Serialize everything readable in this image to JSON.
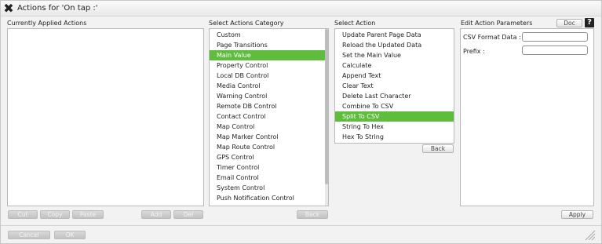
{
  "window": {
    "title": "Actions for 'On tap :'",
    "close_icon": "close-x-icon"
  },
  "applied": {
    "label": "Currently Applied Actions",
    "items": [],
    "buttons": {
      "cut": "Cut",
      "copy": "Copy",
      "paste": "Paste",
      "add": "Add",
      "del": "Del"
    }
  },
  "categories": {
    "label": "Select Actions Category",
    "items": [
      "Custom",
      "Page Transitions",
      "Main Value",
      "Property Control",
      "Local DB Control",
      "Media Control",
      "Warning Control",
      "Remote DB Control",
      "Contact Control",
      "Map Control",
      "Map Marker Control",
      "Map Route Control",
      "GPS Control",
      "Timer Control",
      "Email Control",
      "System Control",
      "Push Notification Control"
    ],
    "selected": "Main Value",
    "back": "Back"
  },
  "actions": {
    "label": "Select Action",
    "items": [
      "Update Parent Page Data",
      "Reload the Updated Data",
      "Set the Main Value",
      "Calculate",
      "Append Text",
      "Clear Text",
      "Delete Last Character",
      "Combine To CSV",
      "Split To CSV",
      "String To Hex",
      "Hex To String"
    ],
    "selected": "Split To CSV",
    "back": "Back"
  },
  "params": {
    "label": "Edit Action Parameters",
    "doc": "Doc",
    "help_icon": "help-question-icon",
    "fields": [
      {
        "label": "CSV Format Data :",
        "value": ""
      },
      {
        "label": "Prefix :",
        "value": ""
      }
    ],
    "apply": "Apply"
  },
  "footer": {
    "cancel": "Cancel",
    "ok": "OK"
  },
  "colors": {
    "selection": "#5fbd3e",
    "panel_border": "#b9b9b9",
    "dialog_bg": "#f2f2f2"
  }
}
